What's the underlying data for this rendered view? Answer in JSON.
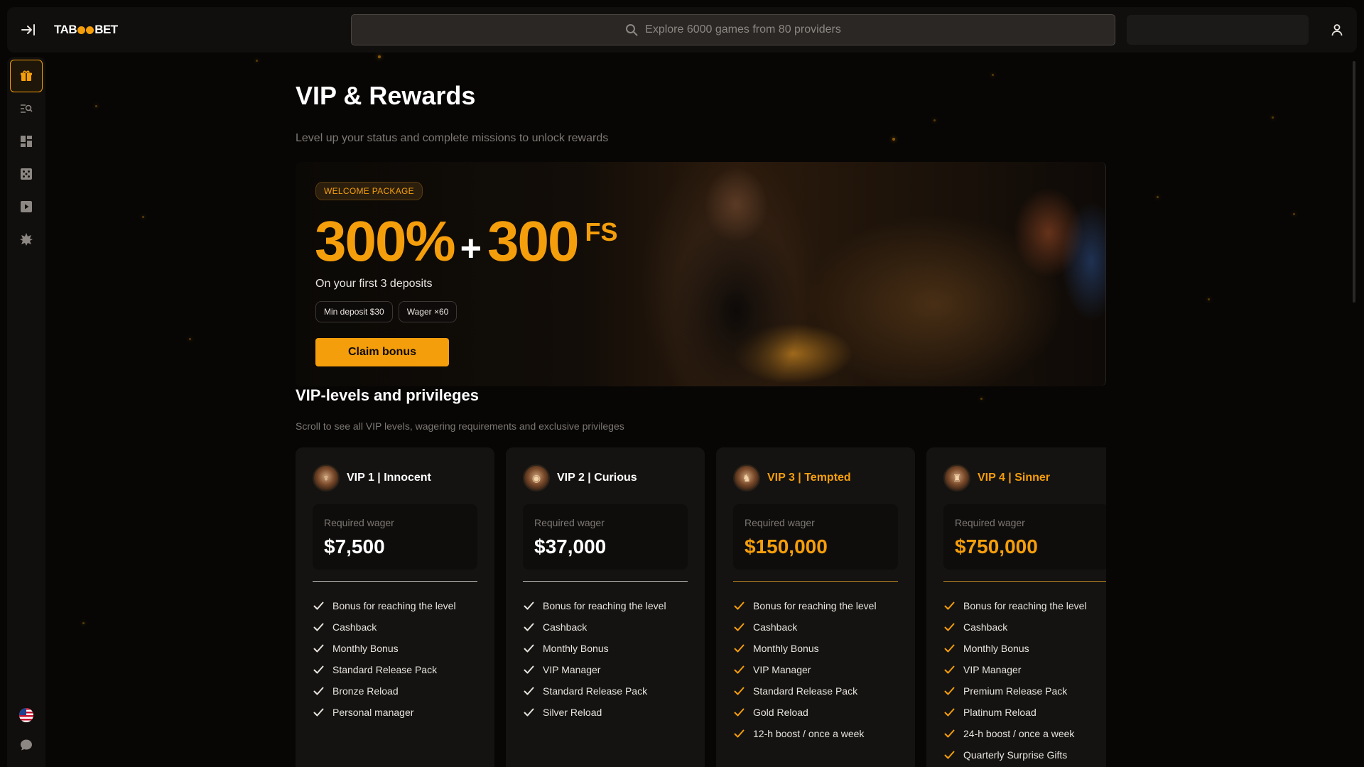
{
  "header": {
    "logo_left": "TAB",
    "logo_right": "BET",
    "search_placeholder": "Explore 6000 games from 80 providers"
  },
  "sidebar": {
    "items": [
      {
        "icon": "gift-icon",
        "active": true
      },
      {
        "icon": "search-list-icon",
        "active": false
      },
      {
        "icon": "dashboard-icon",
        "active": false
      },
      {
        "icon": "dice-icon",
        "active": false
      },
      {
        "icon": "play-icon",
        "active": false
      },
      {
        "icon": "sparkle-icon",
        "active": false
      }
    ],
    "bottom": [
      "us-flag-icon",
      "chat-icon"
    ]
  },
  "page": {
    "title": "VIP & Rewards",
    "subtitle": "Level up your status and complete missions to unlock rewards"
  },
  "banner": {
    "badge": "WELCOME PACKAGE",
    "percent": "300%",
    "plus": "+",
    "spins": "300",
    "spins_unit": "FS",
    "subtitle": "On your first 3 deposits",
    "chips": [
      "Min deposit $30",
      "Wager ×60"
    ],
    "cta": "Claim bonus"
  },
  "vip_section": {
    "title": "VIP-levels and privileges",
    "subtitle": "Scroll to see all VIP levels, wagering requirements and exclusive privileges",
    "wager_label": "Required wager",
    "levels": [
      {
        "name": "VIP 1 | Innocent",
        "wager": "$7,500",
        "accent": "#ffffff",
        "perks": [
          "Bonus for reaching the level",
          "Cashback",
          "Monthly Bonus",
          "Standard Release Pack",
          "Bronze Reload",
          "Personal manager"
        ]
      },
      {
        "name": "VIP 2 | Curious",
        "wager": "$37,000",
        "accent": "#ffffff",
        "perks": [
          "Bonus for reaching the level",
          "Cashback",
          "Monthly Bonus",
          "VIP Manager",
          "Standard Release Pack",
          "Silver Reload"
        ]
      },
      {
        "name": "VIP 3 | Tempted",
        "wager": "$150,000",
        "accent": "#f59e0b",
        "perks": [
          "Bonus for reaching the level",
          "Cashback",
          "Monthly Bonus",
          "VIP Manager",
          "Standard Release Pack",
          "Gold Reload",
          "12-h boost / once a week"
        ]
      },
      {
        "name": "VIP 4 | Sinner",
        "wager": "$750,000",
        "accent": "#f59e0b",
        "perks": [
          "Bonus for reaching the level",
          "Cashback",
          "Monthly Bonus",
          "VIP Manager",
          "Premium Release Pack",
          "Platinum Reload",
          "24-h boost / once a week",
          "Quarterly Surprise Gifts"
        ]
      }
    ]
  },
  "colors": {
    "accent": "#f59e0b",
    "background": "#070605",
    "panel": "#100f0d",
    "card": "#141311"
  }
}
